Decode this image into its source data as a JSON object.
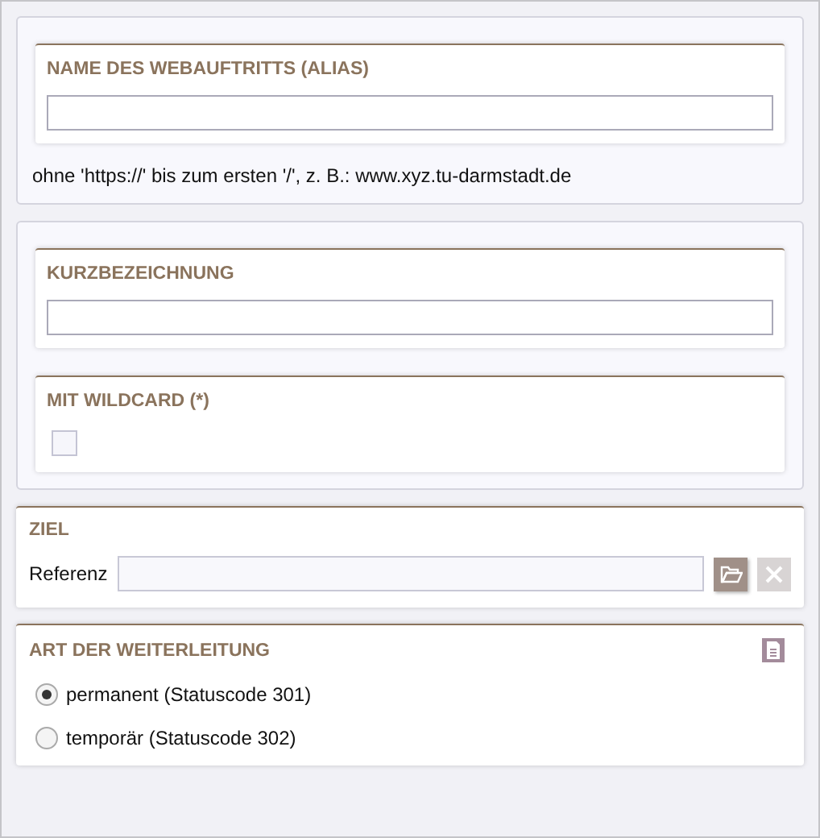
{
  "groups": [
    {
      "fields": [
        {
          "kind": "text",
          "label": "NAME DES WEBAUFTRITTS (ALIAS)"
        }
      ],
      "hint": "ohne 'https://' bis zum ersten '/', z. B.: www.xyz.tu-darmstadt.de"
    },
    {
      "fields": [
        {
          "kind": "text",
          "label": "KURZBEZEICHNUNG"
        },
        {
          "kind": "checkbox",
          "label": "MIT WILDCARD (*)",
          "checked": false
        }
      ]
    }
  ],
  "target": {
    "title": "ZIEL",
    "label": "Referenz",
    "clear_disabled": true
  },
  "redirect": {
    "title": "ART DER WEITERLEITUNG",
    "options": [
      {
        "label": "permanent (Statuscode 301)",
        "selected": true
      },
      {
        "label": "temporär (Statuscode 302)",
        "selected": false
      }
    ]
  }
}
